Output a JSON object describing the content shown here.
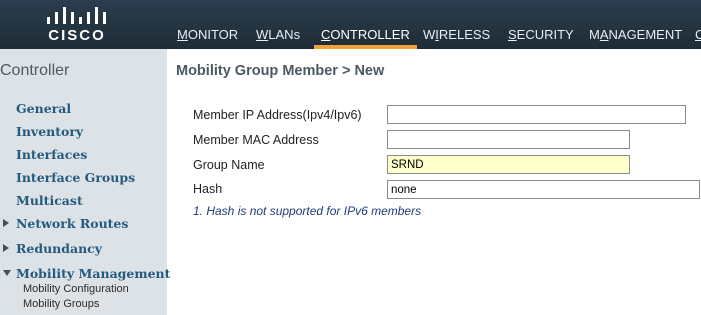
{
  "header": {
    "logo_text": "CISCO",
    "nav": [
      {
        "label": "MONITOR",
        "ul": "M",
        "rest": "ONITOR"
      },
      {
        "label": "WLANs",
        "ul": "W",
        "rest": "LANs"
      },
      {
        "label": "CONTROLLER",
        "ul": "C",
        "rest": "ONTROLLER",
        "active": true
      },
      {
        "label": "WIRELESS",
        "pre": "W",
        "ul": "I",
        "rest": "RELESS"
      },
      {
        "label": "SECURITY",
        "ul": "S",
        "rest": "ECURITY"
      },
      {
        "label": "MANAGEMENT",
        "pre": "M",
        "ul": "A",
        "rest": "NAGEMENT"
      },
      {
        "label": "C",
        "ul": "C",
        "rest": ""
      }
    ]
  },
  "sidebar": {
    "title": "Controller",
    "items": [
      {
        "label": "General"
      },
      {
        "label": "Inventory"
      },
      {
        "label": "Interfaces"
      },
      {
        "label": "Interface Groups"
      },
      {
        "label": "Multicast"
      },
      {
        "label": "Network Routes"
      },
      {
        "label": "Redundancy"
      },
      {
        "label": "Mobility Management"
      }
    ],
    "subitems": [
      {
        "label": "Mobility Configuration"
      },
      {
        "label": "Mobility Groups"
      }
    ]
  },
  "main": {
    "title": "Mobility Group Member > New",
    "fields": [
      {
        "label": "Member IP Address(Ipv4/Ipv6)",
        "value": ""
      },
      {
        "label": "Member MAC Address",
        "value": ""
      },
      {
        "label": "Group Name",
        "value": "SRND"
      },
      {
        "label": "Hash",
        "value": "none"
      }
    ],
    "note": "1. Hash is not supported for IPv6 members"
  },
  "colors": {
    "header_bg": "#23333f",
    "active_tab_underline": "#f1a13a",
    "sidebar_bg": "#dde2e6",
    "sidebar_link": "#235a7f",
    "highlight_input": "#ffffcc",
    "note_text": "#1e3c7a"
  }
}
